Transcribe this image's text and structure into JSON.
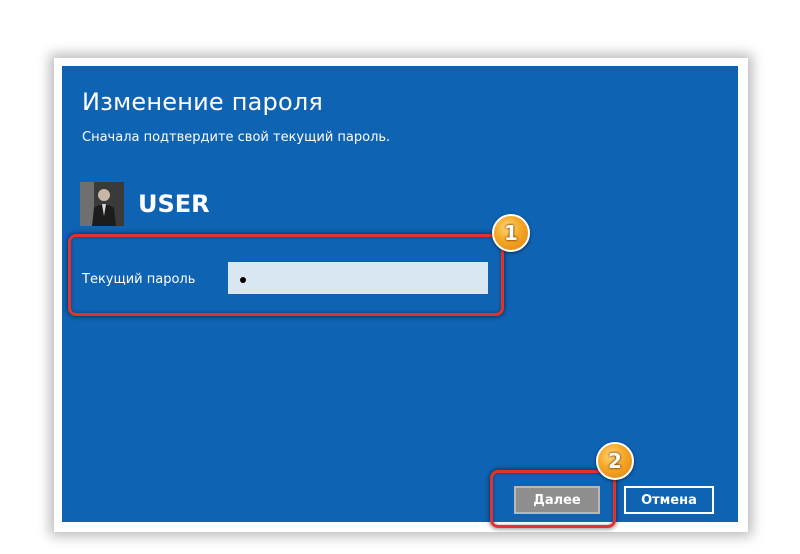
{
  "dialog": {
    "title": "Изменение пароля",
    "subtitle": "Сначала подтвердите свой текущий пароль.",
    "background_color": "#0f63b3"
  },
  "user": {
    "name": "USER",
    "avatar_icon": "user-photo"
  },
  "password": {
    "label": "Текущий пароль",
    "value": "•"
  },
  "buttons": {
    "next_label": "Далее",
    "cancel_label": "Отмена"
  },
  "annotations": {
    "step1": "1",
    "step2": "2",
    "highlight_color": "#e0322e",
    "badge_color": "#f5a623"
  }
}
